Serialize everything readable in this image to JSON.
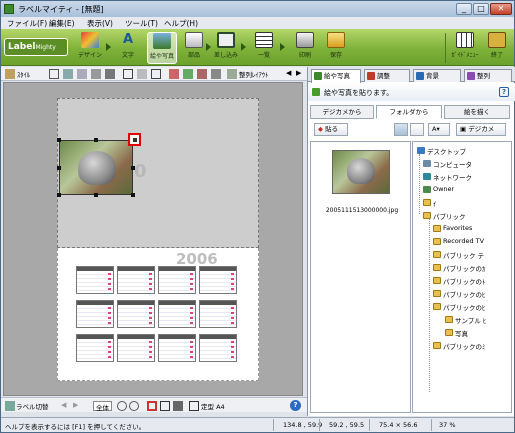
{
  "window": {
    "title": "ラベルマイティ - [無題]",
    "buttons": [
      "_",
      "□",
      "✕"
    ]
  },
  "menu": [
    "ファイル(F)",
    "編集(E)",
    "表示(V)",
    "ツール(T)",
    "ヘルプ(H)"
  ],
  "logo": {
    "main": "Label",
    "sub": "Mighty"
  },
  "ribbon": {
    "tools": [
      {
        "label": "デザイン",
        "icon": "design-palette-icon"
      },
      {
        "label": "文字",
        "icon": "text-a-icon"
      },
      {
        "label": "絵や写真",
        "icon": "picture-icon",
        "selected": true
      },
      {
        "label": "部品",
        "icon": "parts-icon"
      },
      {
        "label": "差し込み",
        "icon": "merge-icon"
      },
      {
        "label": "一覧",
        "icon": "list-icon"
      },
      {
        "label": "印刷",
        "icon": "printer-icon"
      },
      {
        "label": "保存",
        "icon": "save-folder-icon"
      }
    ],
    "right_tools": [
      {
        "label": "ｶﾞｲﾄﾞﾒﾆｭｰ",
        "icon": "guide-menu-icon"
      },
      {
        "label": "終了",
        "icon": "exit-icon"
      }
    ]
  },
  "toolbar2": {
    "style_label": "ｽﾀｲﾙ",
    "layout_label": "整列ﾚｲｱｳﾄ"
  },
  "canvas": {
    "faint_number_1": "0",
    "faint_year": "2006"
  },
  "bottom": {
    "label_list": "ラベル切替",
    "zoom": "全体",
    "size": "定型 A4",
    "help": "?"
  },
  "status": {
    "message": "ヘルプを表示するには [F1] を押してください。",
    "pos1": "134.8 , 59.9",
    "pos2": "59.2 , 59.5",
    "size": "75.4 × 56.6",
    "zoom": "37 %"
  },
  "panel": {
    "tabs": [
      {
        "label": "絵や写真",
        "active": true,
        "color": "#3a8a2a"
      },
      {
        "label": "調整",
        "active": false,
        "color": "#c0392b"
      },
      {
        "label": "背景",
        "active": false,
        "color": "#2a6ab0"
      },
      {
        "label": "整列",
        "active": false,
        "color": "#8a4ab0"
      }
    ],
    "header": "絵や写真を貼ります。",
    "subtabs": [
      "デジカメから",
      "フォルダから",
      "絵を描く"
    ],
    "active_subtab": 1,
    "buttons": {
      "paste": "貼る",
      "cursor": "A",
      "digicam": "デジカメ"
    },
    "thumb_filename": "2005111513000000.jpg",
    "tree": [
      {
        "label": "デスクトップ",
        "level": 0,
        "icon": "desktop"
      },
      {
        "label": "コンピュータ",
        "level": 1,
        "icon": "computer"
      },
      {
        "label": "ネットワーク",
        "level": 1,
        "icon": "network"
      },
      {
        "label": "Owner",
        "level": 1,
        "icon": "user"
      },
      {
        "label": "ｲ",
        "level": 1,
        "icon": "folder"
      },
      {
        "label": "パブリック",
        "level": 1,
        "icon": "folder"
      },
      {
        "label": "Favorites",
        "level": 2,
        "icon": "folder"
      },
      {
        "label": "Recorded TV",
        "level": 2,
        "icon": "folder"
      },
      {
        "label": "パブリック テ",
        "level": 2,
        "icon": "folder"
      },
      {
        "label": "パブリックのｶ",
        "level": 2,
        "icon": "folder"
      },
      {
        "label": "パブリックのﾄ",
        "level": 2,
        "icon": "folder"
      },
      {
        "label": "パブリックのﾋ",
        "level": 2,
        "icon": "folder"
      },
      {
        "label": "パブリックのﾋ",
        "level": 2,
        "icon": "folder"
      },
      {
        "label": "サンプル ﾋ",
        "level": 3,
        "icon": "folder"
      },
      {
        "label": "写真",
        "level": 3,
        "icon": "folder"
      },
      {
        "label": "パブリックのﾐ",
        "level": 2,
        "icon": "folder"
      }
    ]
  }
}
